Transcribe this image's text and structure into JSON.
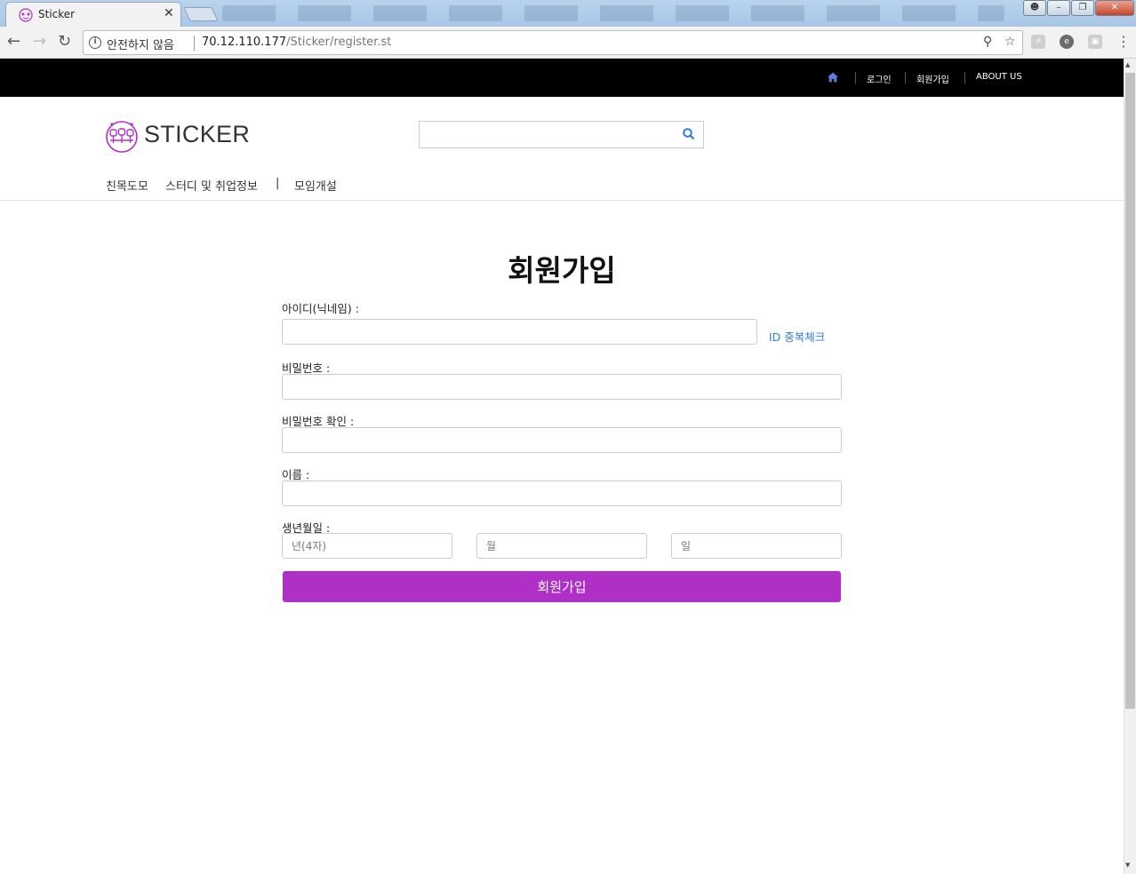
{
  "browser": {
    "tab_title": "Sticker",
    "security_text": "안전하지 않음",
    "url_host": "70.12.110.177",
    "url_path": "/Sticker/register.st"
  },
  "topnav": {
    "login": "로그인",
    "signup": "회원가입",
    "about": "ABOUT US"
  },
  "header": {
    "logo_text": "STICKER",
    "search_value": ""
  },
  "category_nav": [
    "친목도모",
    "스터디 및 취업정보",
    "|",
    "모임개설"
  ],
  "form": {
    "title": "회원가입",
    "id_label": "아이디(닉네임) :",
    "id_check": "ID 중복체크",
    "password_label": "비밀번호 :",
    "password_confirm_label": "비밀번호 확인 :",
    "name_label": "이름 :",
    "birth_label": "생년월일 :",
    "year_placeholder": "년(4자)",
    "month_placeholder": "월",
    "day_placeholder": "일",
    "submit_label": "회원가입"
  },
  "colors": {
    "accent": "#b030c7",
    "link": "#2e7be0",
    "topnav_bg": "#000000"
  }
}
